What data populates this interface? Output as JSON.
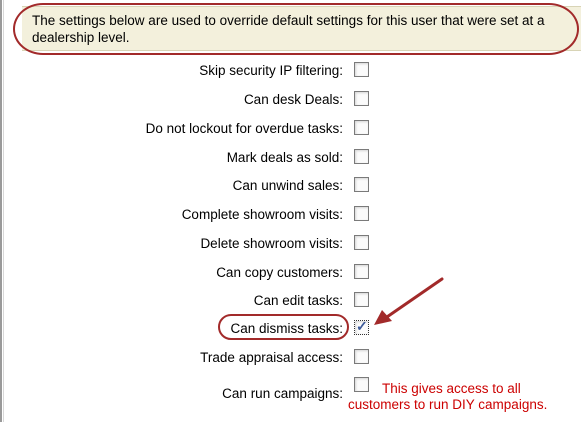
{
  "banner": {
    "text": "The settings below are used to override default settings for this user that were set at a dealership level."
  },
  "settings": [
    {
      "label": "Skip security IP filtering:",
      "checked": false
    },
    {
      "label": "Can desk Deals:",
      "checked": false
    },
    {
      "label": "Do not lockout for overdue tasks:",
      "checked": false
    },
    {
      "label": "Mark deals as sold:",
      "checked": false
    },
    {
      "label": "Can unwind sales:",
      "checked": false
    },
    {
      "label": "Complete showroom visits:",
      "checked": false
    },
    {
      "label": "Delete showroom visits:",
      "checked": false
    },
    {
      "label": "Can copy customers:",
      "checked": false
    },
    {
      "label": "Can edit tasks:",
      "checked": false
    },
    {
      "label": "Can dismiss tasks:",
      "checked": true
    },
    {
      "label": "Trade appraisal access:",
      "checked": false
    },
    {
      "label": "Can run campaigns:",
      "checked": false
    }
  ],
  "note": {
    "line1": "This gives access to all",
    "line2": "customers to run DIY campaigns."
  },
  "colors": {
    "annotation": "#a22a2a",
    "note_text": "#cc0000",
    "banner_bg": "#f3f0dc"
  }
}
